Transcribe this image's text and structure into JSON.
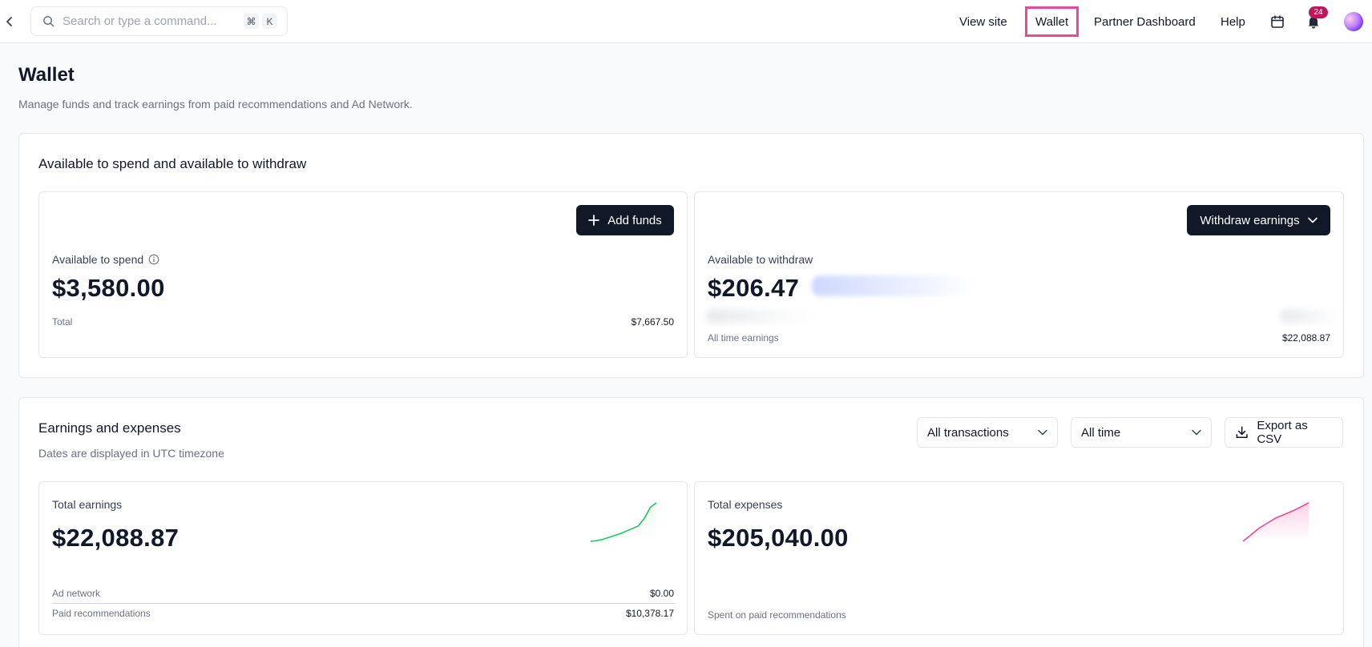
{
  "topbar": {
    "search_placeholder": "Search or type a command...",
    "shortcut_keys": [
      "⌘",
      "K"
    ],
    "nav": {
      "view_site": "View site",
      "wallet": "Wallet",
      "partner_dashboard": "Partner Dashboard",
      "help": "Help"
    },
    "notification_count": "24",
    "active_nav": "wallet",
    "active_highlight_color": "#ec4899",
    "icons": [
      "chevron-left-icon",
      "search-icon",
      "calendar-icon",
      "bell-icon"
    ]
  },
  "page": {
    "title": "Wallet",
    "subtitle": "Manage funds and track earnings from paid recommendations and Ad Network."
  },
  "balances": {
    "title": "Available to spend and available to withdraw",
    "spend": {
      "button": "Add funds",
      "label": "Available to spend",
      "amount": "$3,580.00",
      "total_label": "Total",
      "total_value": "$7,667.50"
    },
    "withdraw": {
      "button": "Withdraw earnings",
      "label": "Available to withdraw",
      "amount": "$206.47",
      "all_time_label": "All time earnings",
      "all_time_value": "$22,088.87"
    }
  },
  "earnings": {
    "title": "Earnings and expenses",
    "subtitle": "Dates are displayed in UTC timezone",
    "filter_type": "All transactions",
    "filter_range": "All time",
    "export_label": "Export as CSV",
    "total_earnings": {
      "label": "Total earnings",
      "amount": "$22,088.87",
      "rows": [
        {
          "label": "Ad network",
          "value": "$0.00"
        },
        {
          "label": "Paid recommendations",
          "value": "$10,378.17"
        }
      ],
      "spark_color": "#22c55e",
      "sparkline": [
        2,
        3,
        5,
        8,
        11,
        14,
        18,
        22,
        26,
        38,
        55,
        62
      ]
    },
    "total_expenses": {
      "label": "Total expenses",
      "amount": "$205,040.00",
      "footer": "Spent on paid recommendations",
      "spark_color": "#ec4899",
      "sparkline": [
        2,
        10,
        18,
        24,
        30,
        34,
        38,
        43,
        48
      ]
    }
  }
}
